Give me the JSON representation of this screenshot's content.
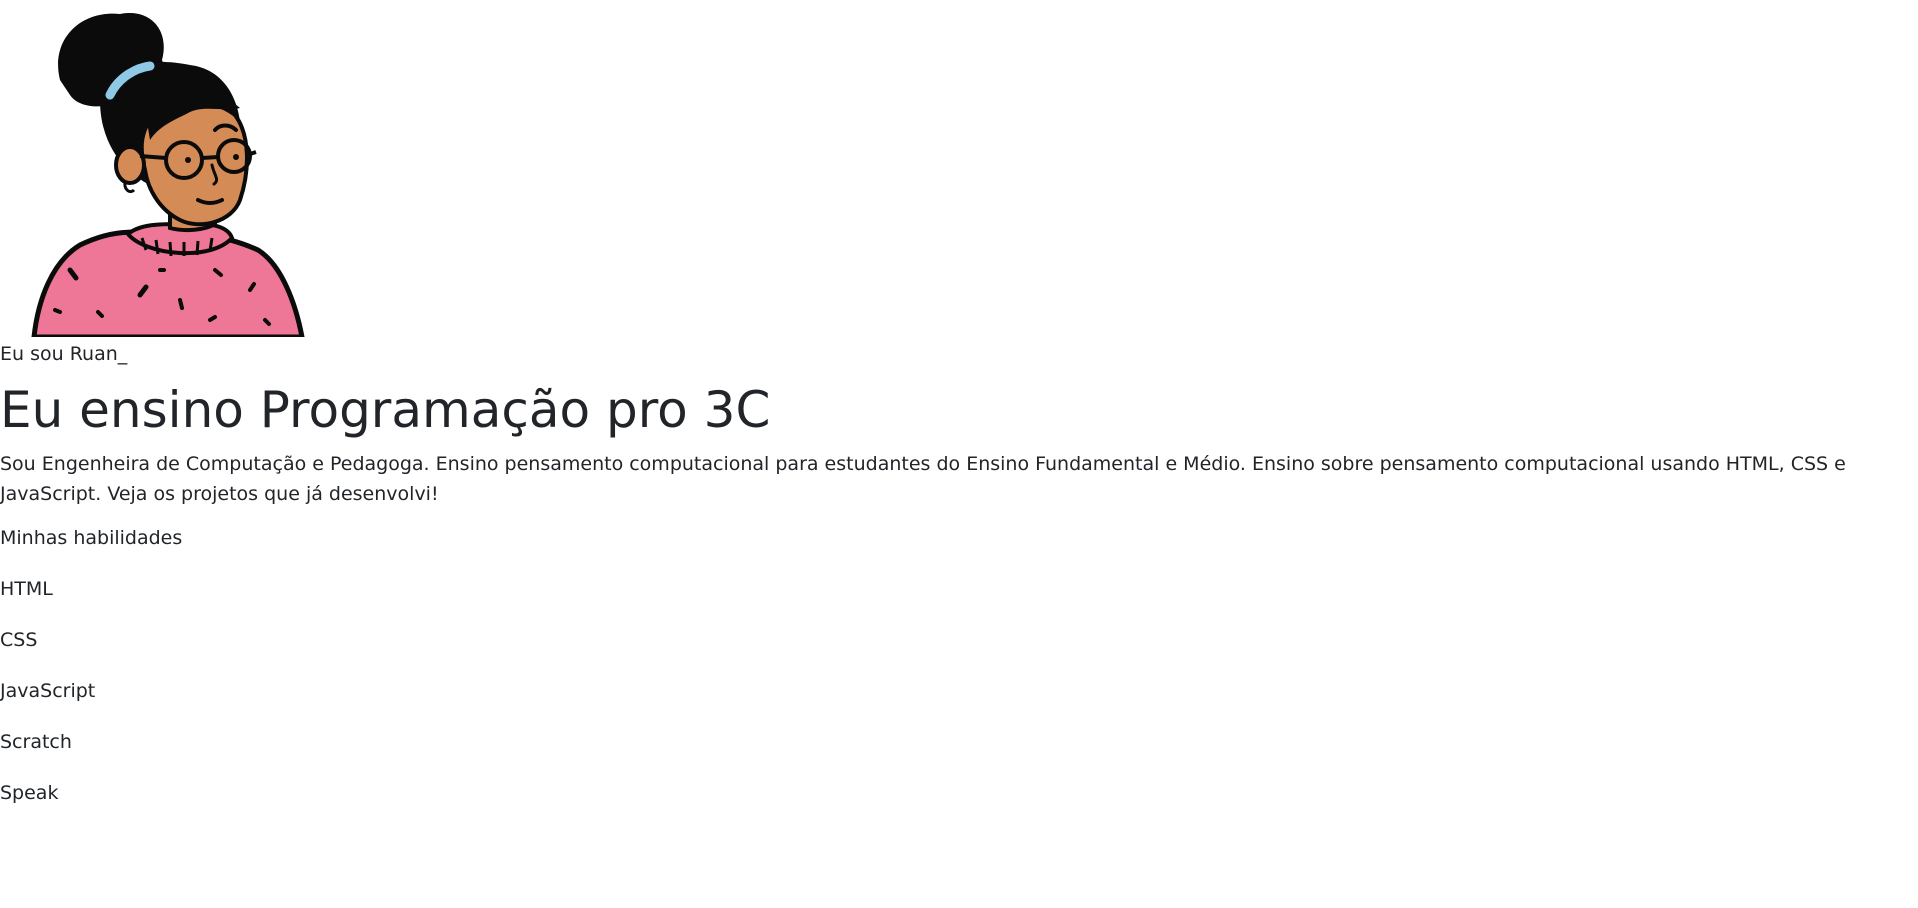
{
  "profile": {
    "intro": "Eu sou Ruan_",
    "headline": "Eu ensino Programação pro 3C",
    "bio": "Sou Engenheira de Computação e Pedagoga. Ensino pensamento computacional para estudantes do Ensino Fundamental e Médio. Ensino sobre pensamento computacional usando HTML, CSS e JavaScript. Veja os projetos que já desenvolvi!",
    "avatar_icon": "woman-with-glasses-illustration"
  },
  "skills": {
    "title": "Minhas habilidades",
    "items": [
      "HTML",
      "CSS",
      "JavaScript",
      "Scratch",
      "Speak"
    ]
  },
  "colors": {
    "sweater": "#ee7696",
    "skin": "#d48b55",
    "hair": "#0b0b0b",
    "hair_band": "#8fc9e6",
    "text": "#212529"
  }
}
